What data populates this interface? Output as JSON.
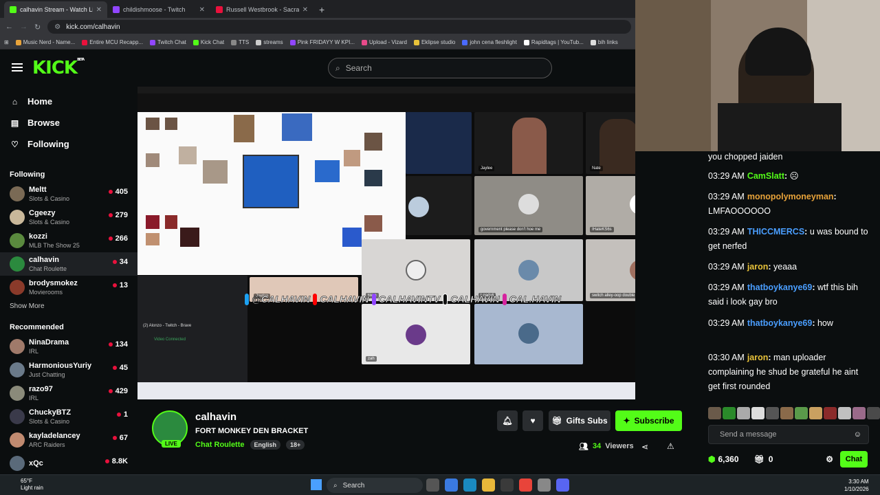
{
  "browser": {
    "tabs": [
      {
        "label": "calhavin Stream - Watch Li",
        "active": true,
        "color": "#53fc18"
      },
      {
        "label": "childishmoose - Twitch",
        "active": false,
        "color": "#9146ff"
      },
      {
        "label": "Russell Westbrook - Sacrament",
        "active": false,
        "color": "#e9113c"
      }
    ],
    "url": "kick.com/calhavin",
    "bookmarks": [
      "Music Nerd - Name...",
      "Entire MCU Recapp...",
      "Twitch Chat",
      "Kick Chat",
      "TTS",
      "streams",
      "Pink FRIDAYY W KPI...",
      "Upload - Vizard",
      "Eklipse studio",
      "john cena fleshlight",
      "Rapidtags | YouTub...",
      "bih links"
    ]
  },
  "header": {
    "logo": "KICK",
    "logo_badge": "BETA",
    "search_placeholder": "Search"
  },
  "sidebar": {
    "nav": [
      {
        "label": "Home",
        "icon": "home-icon"
      },
      {
        "label": "Browse",
        "icon": "browse-icon"
      },
      {
        "label": "Following",
        "icon": "heart-icon"
      }
    ],
    "following_title": "Following",
    "following": [
      {
        "name": "Meltt",
        "category": "Slots & Casino",
        "viewers": "405",
        "color": "#7a6a55"
      },
      {
        "name": "Cgeezy",
        "category": "Slots & Casino",
        "viewers": "279",
        "color": "#c9b89a"
      },
      {
        "name": "kozzi",
        "category": "MLB The Show 25",
        "viewers": "266",
        "color": "#5a8a3e"
      },
      {
        "name": "calhavin",
        "category": "Chat Roulette",
        "viewers": "34",
        "color": "#2b8a3e"
      },
      {
        "name": "brodysmokez",
        "category": "Movierooms",
        "viewers": "13",
        "color": "#8a3a2a"
      }
    ],
    "show_more": "Show More",
    "recommended_title": "Recommended",
    "recommended": [
      {
        "name": "NinaDrama",
        "category": "IRL",
        "viewers": "134",
        "color": "#a07a6a"
      },
      {
        "name": "HarmoniousYuriy",
        "category": "Just Chatting",
        "viewers": "45",
        "color": "#6a7a8a"
      },
      {
        "name": "razo97",
        "category": "IRL",
        "viewers": "429",
        "color": "#8a8a7a"
      },
      {
        "name": "ChuckyBTZ",
        "category": "Slots & Casino",
        "viewers": "1",
        "color": "#3a3a4a"
      },
      {
        "name": "kayladelancey",
        "category": "ARC Raiders",
        "viewers": "67",
        "color": "#c08a70"
      },
      {
        "name": "xQc",
        "category": "",
        "viewers": "8.8K",
        "color": "#5a6a7a"
      }
    ]
  },
  "video": {
    "tile_labels": [
      "Jaylee",
      "Nate",
      "government please don't hoe me",
      "IHateKS6s",
      "Jordan",
      "kiem",
      "Loadali",
      "switch alley-oop double mctwist",
      "zah"
    ],
    "discord_title": "(2) Alonzo - Twitch - Brave",
    "discord_status": "Video Connected",
    "social_handles": [
      "@CALHAVIN",
      "CALHAVIN",
      "CALHAVINTV",
      "CALHAVIN",
      "CAL.HAVIN"
    ]
  },
  "stream": {
    "streamer": "calhavin",
    "live_badge": "LIVE",
    "title": "FORT MONKEY DEN BRACKET",
    "category": "Chat Roulette",
    "tags": [
      "English",
      "18+"
    ],
    "gift_label": "Gifts Subs",
    "subscribe_label": "Subscribe",
    "viewers_count": "34",
    "viewers_label": "Viewers"
  },
  "chat": {
    "first_line": "you chopped jaiden",
    "messages": [
      {
        "time": "03:29 AM",
        "user": "CamSlatt",
        "color": "#53fc18",
        "text": "☹"
      },
      {
        "time": "03:29 AM",
        "user": "monopolymoneyman",
        "color": "#e8a33a",
        "text": "LMFAOOOOOO"
      },
      {
        "time": "03:29 AM",
        "user": "THICCMERCS",
        "color": "#4a9eff",
        "text": "u was bound to get nerfed"
      },
      {
        "time": "03:29 AM",
        "user": "jaron",
        "color": "#e8c23a",
        "text": "yeaaa"
      },
      {
        "time": "03:29 AM",
        "user": "thatboykanye69",
        "color": "#4a9eff",
        "text": "wtf this bih said i look gay bro"
      },
      {
        "time": "03:29 AM",
        "user": "thatboykanye69",
        "color": "#4a9eff",
        "text": "how"
      },
      {
        "time": "03:30 AM",
        "user": "jaron",
        "color": "#e8c23a",
        "text": "man uploader complaining he shud be grateful he aint get first rounded"
      }
    ],
    "input_placeholder": "Send a message",
    "points": "6,360",
    "gift_count": "0",
    "chat_button": "Chat"
  },
  "taskbar": {
    "weather_temp": "65°F",
    "weather_desc": "Light rain",
    "search_label": "Search",
    "time": "3:30 AM",
    "date": "1/10/2026"
  },
  "colors": {
    "accent": "#53fc18",
    "background": "#0b0e0f"
  }
}
